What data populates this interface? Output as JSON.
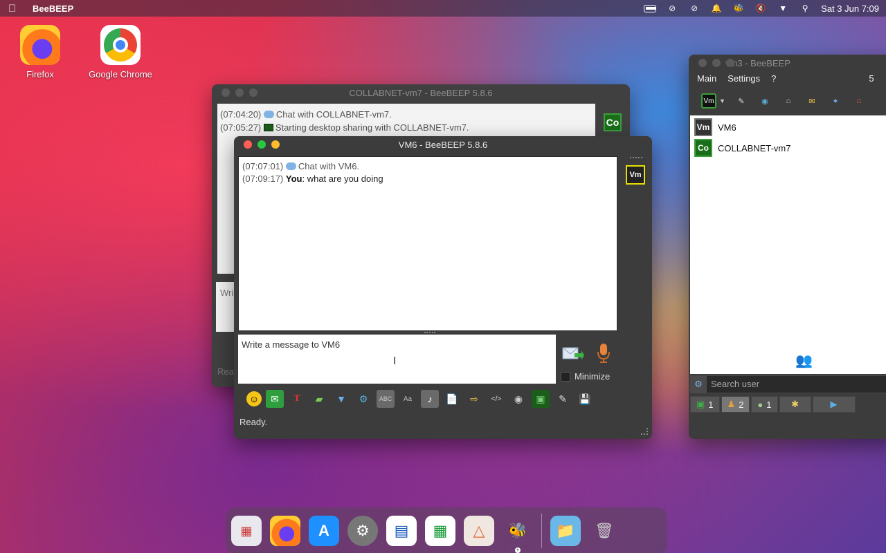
{
  "menubar": {
    "app_name": "BeeBEEP",
    "clock": "Sat 3 Jun 7:09"
  },
  "desktop": {
    "icons": [
      {
        "label": "Firefox"
      },
      {
        "label": "Google Chrome"
      }
    ]
  },
  "back_window": {
    "title": "COLLABNET-vm7 - BeeBEEP 5.8.6",
    "messages": [
      {
        "time": "(07:04:20)",
        "text": "Chat with COLLABNET-vm7."
      },
      {
        "time": "(07:05:27)",
        "text": "Starting desktop sharing with COLLABNET-vm7."
      }
    ],
    "avatar": "Co",
    "input_partial": "Wri",
    "status_partial": "Rea"
  },
  "vm6_window": {
    "title": "VM6 - BeeBEEP 5.8.6",
    "messages": [
      {
        "time": "(07:07:01)",
        "text": "Chat with VM6."
      },
      {
        "time": "(07:09:17)",
        "sender": "You",
        "text": ": what are you doing"
      }
    ],
    "avatar": "Vm",
    "input_placeholder": "Write a message to VM6",
    "minimize_label": "Minimize",
    "status": "Ready."
  },
  "vm3_window": {
    "title": "vm3 - BeeBEEP",
    "menu": [
      "Main",
      "Settings",
      "?"
    ],
    "users": [
      {
        "avatar": "Vm",
        "name": "VM6"
      },
      {
        "avatar": "Co",
        "name": "COLLABNET-vm7"
      }
    ],
    "search_placeholder": "Search user",
    "tabs": [
      {
        "icon": "monitor-icon",
        "count": "1"
      },
      {
        "icon": "people-icon",
        "count": "2"
      },
      {
        "icon": "chat-icon",
        "count": "1"
      },
      {
        "icon": "group-icon",
        "count": ""
      },
      {
        "icon": "share-icon",
        "count": ""
      }
    ],
    "right_edge_digit": "5"
  },
  "colors": {
    "accent_green": "#3c9f3c",
    "avatar_yellow": "#e8e000",
    "close_red": "#ff5f57",
    "minimize_yellow": "#febc2e",
    "zoom_green": "#28c840"
  }
}
